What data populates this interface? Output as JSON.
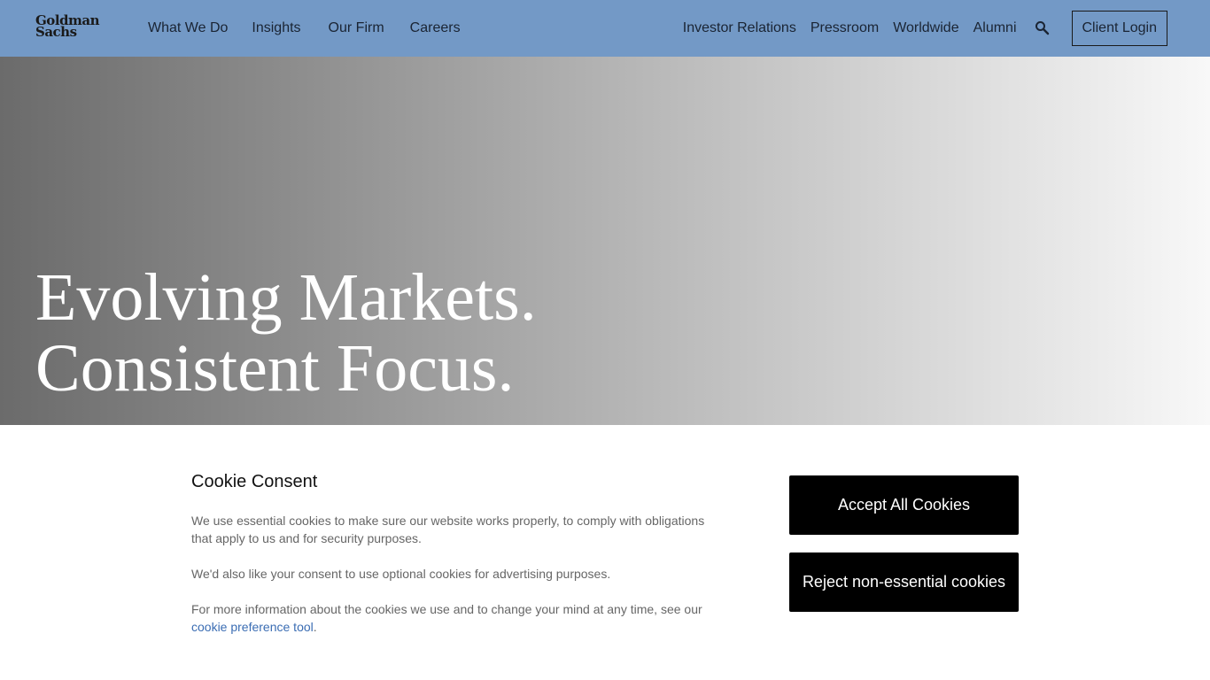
{
  "header": {
    "logo_line1": "Goldman",
    "logo_line2": "Sachs",
    "nav_primary": [
      "What We Do",
      "Insights",
      "Our Firm",
      "Careers"
    ],
    "nav_secondary": [
      "Investor Relations",
      "Pressroom",
      "Worldwide",
      "Alumni"
    ],
    "search_icon": "search-icon",
    "client_login_label": "Client Login",
    "background_color": "#7399c6"
  },
  "hero": {
    "title_line1": "Evolving Markets.",
    "title_line2": "Consistent Focus."
  },
  "cookie_banner": {
    "title": "Cookie Consent",
    "paragraph1": "We use essential cookies to make sure our website works properly, to comply with obligations that apply to us and for security purposes.",
    "paragraph2": "We'd also like your consent to use optional cookies for advertising purposes.",
    "paragraph3_prefix": "For more information about the cookies we use and to change your mind at any time, see our",
    "paragraph3_link": "cookie preference tool",
    "paragraph3_suffix": ".",
    "accept_label": "Accept All Cookies",
    "reject_label": "Reject non-essential cookies",
    "link_color": "#3b6db3",
    "button_color": "#000000"
  }
}
